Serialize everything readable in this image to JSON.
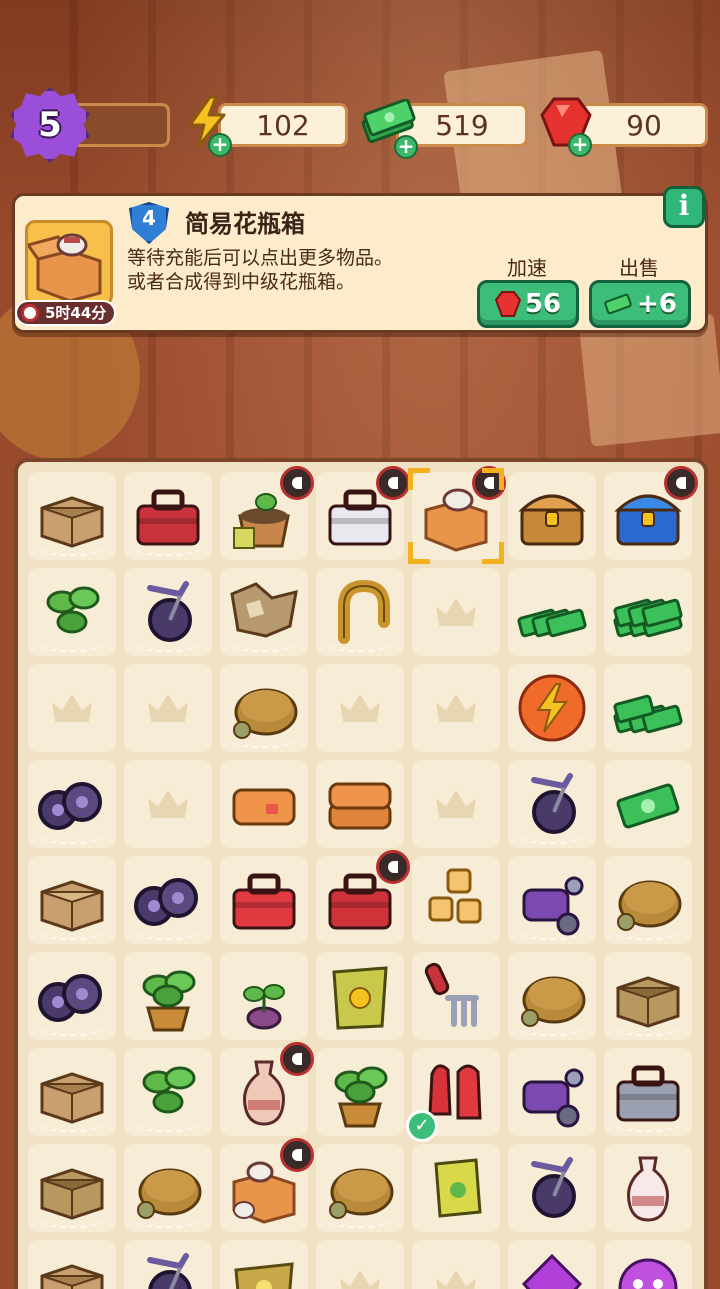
{
  "top_bar": {
    "level": "5",
    "energy": "102",
    "cash": "519",
    "gems": "90"
  },
  "info_panel": {
    "item_level": "4",
    "item_title": "简易花瓶箱",
    "description_line1": "等待充能后可以点出更多物品。",
    "description_line2": "或者合成得到中级花瓶箱。",
    "timer": "5时44分",
    "speedup_label": "加速",
    "speedup_cost": "56",
    "sell_label": "出售",
    "sell_value": "+6"
  },
  "colors": {
    "accent_green": "#3cbd7a",
    "brand_purple": "#9b4fd8",
    "board_bg": "#f0e0c4",
    "frame_brown": "#7a4528"
  },
  "board": {
    "rows": [
      [
        "cardboard-box",
        "red-toolbox",
        "plant-pot-seedling",
        "white-toolbox",
        "vase-box-selected",
        "treasure-chest",
        "jeweled-chest"
      ],
      [
        "leafy-plant",
        "purple-bicycle",
        "torn-cardboard",
        "brass-pipe",
        "empty",
        "cash-stack",
        "cash-pile"
      ],
      [
        "empty",
        "empty",
        "tan-cushion",
        "empty",
        "empty",
        "energy-orb",
        "cash-bundle"
      ],
      [
        "purple-wheels",
        "empty",
        "orange-towel",
        "orange-towels",
        "empty",
        "purple-bicycle",
        "cash-bill"
      ],
      [
        "cardboard-box-open",
        "purple-wheels",
        "red-toolbox-open",
        "red-toolbox-tools",
        "sponge-cubes",
        "purple-motorbike",
        "tan-cushion"
      ],
      [
        "purple-wheels",
        "potted-plant",
        "sprout",
        "seed-bag",
        "garden-fork",
        "tan-cushion",
        "wooden-crate"
      ],
      [
        "cardboard-box",
        "leafy-plant",
        "ceramic-vase",
        "potted-sprout",
        "red-gloves",
        "purple-motorbike",
        "metal-toolbox"
      ],
      [
        "wooden-crate",
        "tan-cushion",
        "vase-box",
        "tan-cushion",
        "seed-packet",
        "purple-bicycle",
        "glass-vase"
      ],
      [
        "cardboard-box",
        "purple-bicycle",
        "burlap-sack",
        "empty",
        "empty",
        "purple-gem",
        "purple-creature"
      ]
    ]
  }
}
